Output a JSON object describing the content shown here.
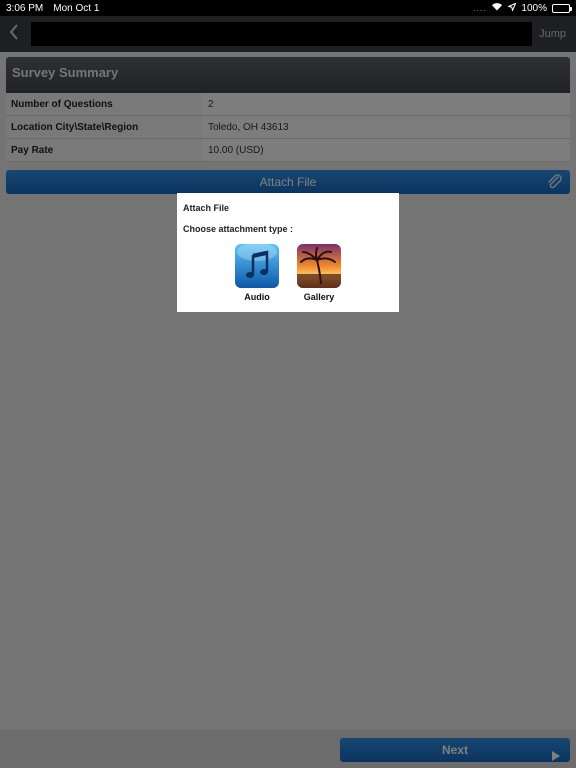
{
  "status_bar": {
    "time": "3:06 PM",
    "date": "Mon Oct 1",
    "signal": "....",
    "battery": "100%"
  },
  "nav": {
    "jump_label": "Jump"
  },
  "summary": {
    "header": "Survey Summary",
    "rows": [
      {
        "label": "Number of Questions",
        "value": "2"
      },
      {
        "label": "Location City\\State\\Region",
        "value": "Toledo, OH 43613"
      },
      {
        "label": "Pay Rate",
        "value": "10.00 (USD)"
      }
    ]
  },
  "attach_bar": {
    "label": "Attach File"
  },
  "dialog": {
    "title": "Attach File",
    "subtitle": "Choose attachment type :",
    "options": [
      {
        "label": "Audio",
        "icon": "music-note-icon"
      },
      {
        "label": "Gallery",
        "icon": "palm-sunset-icon"
      }
    ]
  },
  "footer": {
    "next_label": "Next"
  },
  "colors": {
    "accent_blue": "#1f7ad4",
    "nav_bg": "#3d3f44",
    "overlay": "rgba(0,0,0,0.5)"
  }
}
